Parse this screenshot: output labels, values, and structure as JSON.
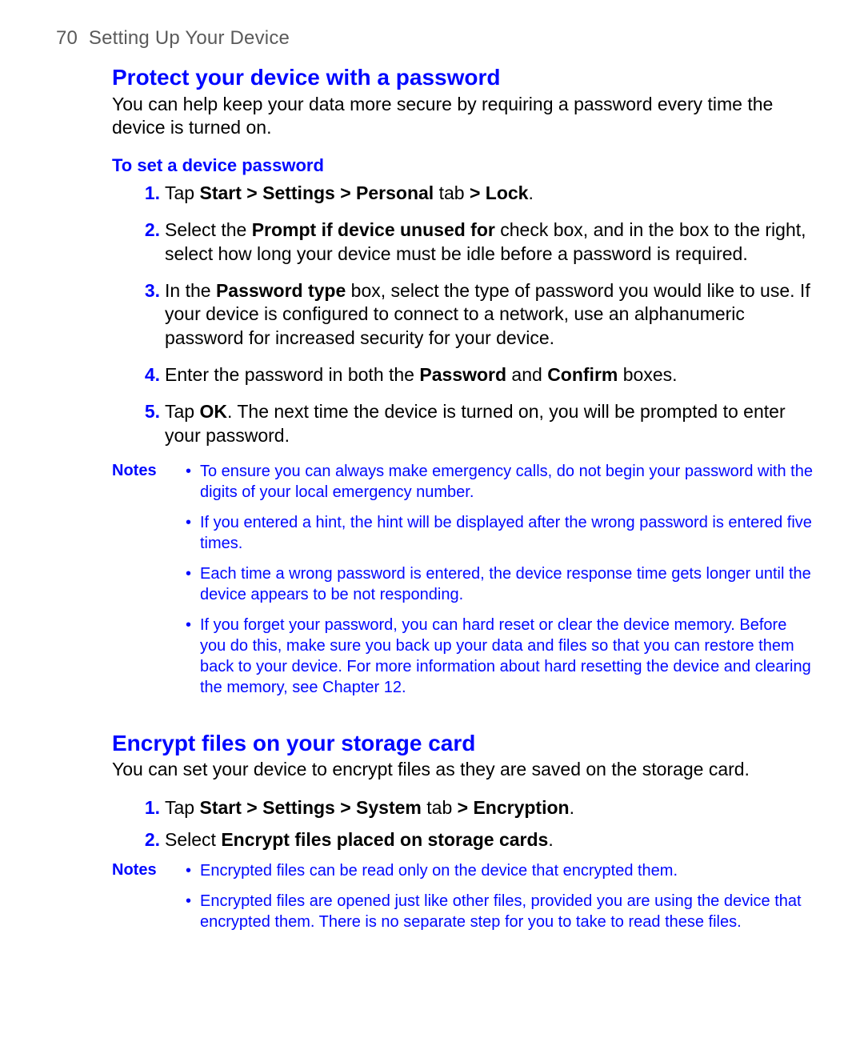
{
  "header": {
    "page_number": "70",
    "chapter": "Setting Up Your Device"
  },
  "sections": [
    {
      "title": "Protect your device with a password",
      "intro": "You can help keep your data more secure by requiring a password every time the device is turned on.",
      "subheading": "To set a device password",
      "steps": [
        {
          "num": "1.",
          "parts": [
            {
              "t": "Tap "
            },
            {
              "t": "Start > Settings > Personal",
              "b": true
            },
            {
              "t": " tab "
            },
            {
              "t": "> Lock",
              "b": true
            },
            {
              "t": "."
            }
          ]
        },
        {
          "num": "2.",
          "parts": [
            {
              "t": "Select the "
            },
            {
              "t": "Prompt if device unused for",
              "b": true
            },
            {
              "t": " check box, and in the box to the right, select how long your device must be idle before a password is required."
            }
          ]
        },
        {
          "num": "3.",
          "parts": [
            {
              "t": "In the "
            },
            {
              "t": "Password type",
              "b": true
            },
            {
              "t": " box, select the type of password you would like to use. If your device is configured to connect to a network, use an alphanumeric password for increased security for your device."
            }
          ]
        },
        {
          "num": "4.",
          "parts": [
            {
              "t": "Enter the password in both the "
            },
            {
              "t": "Password",
              "b": true
            },
            {
              "t": " and "
            },
            {
              "t": "Confirm",
              "b": true
            },
            {
              "t": " boxes."
            }
          ]
        },
        {
          "num": "5.",
          "parts": [
            {
              "t": "Tap "
            },
            {
              "t": "OK",
              "b": true
            },
            {
              "t": ". The next time the device is turned on, you will be prompted to enter your password."
            }
          ]
        }
      ],
      "notes_label": "Notes",
      "notes": [
        "To ensure you can always make emergency calls, do not begin your password with the digits of your local emergency number.",
        "If you entered a hint, the hint will be displayed after the wrong password is entered five times.",
        "Each time a wrong password is entered, the device response time gets longer until the device appears to be not responding.",
        "If you forget your password, you can hard reset or clear the device memory. Before you do this, make sure you back up your data and files so that you can restore them back to your device. For more information about hard resetting the device and clearing the memory, see Chapter 12."
      ]
    },
    {
      "title": "Encrypt files on your storage card",
      "intro": "You can set your device to encrypt files as they are saved on the storage card.",
      "subheading": "",
      "steps": [
        {
          "num": "1.",
          "parts": [
            {
              "t": "Tap "
            },
            {
              "t": "Start > Settings > System",
              "b": true
            },
            {
              "t": " tab "
            },
            {
              "t": "> Encryption",
              "b": true
            },
            {
              "t": "."
            }
          ]
        },
        {
          "num": "2.",
          "parts": [
            {
              "t": "Select "
            },
            {
              "t": "Encrypt files placed on storage cards",
              "b": true
            },
            {
              "t": "."
            }
          ]
        }
      ],
      "notes_label": "Notes",
      "notes": [
        "Encrypted files can be read only on the device that encrypted them.",
        "Encrypted files are opened just like other files, provided you are using the device that encrypted them. There is no separate step for you to take to read these files."
      ]
    }
  ]
}
